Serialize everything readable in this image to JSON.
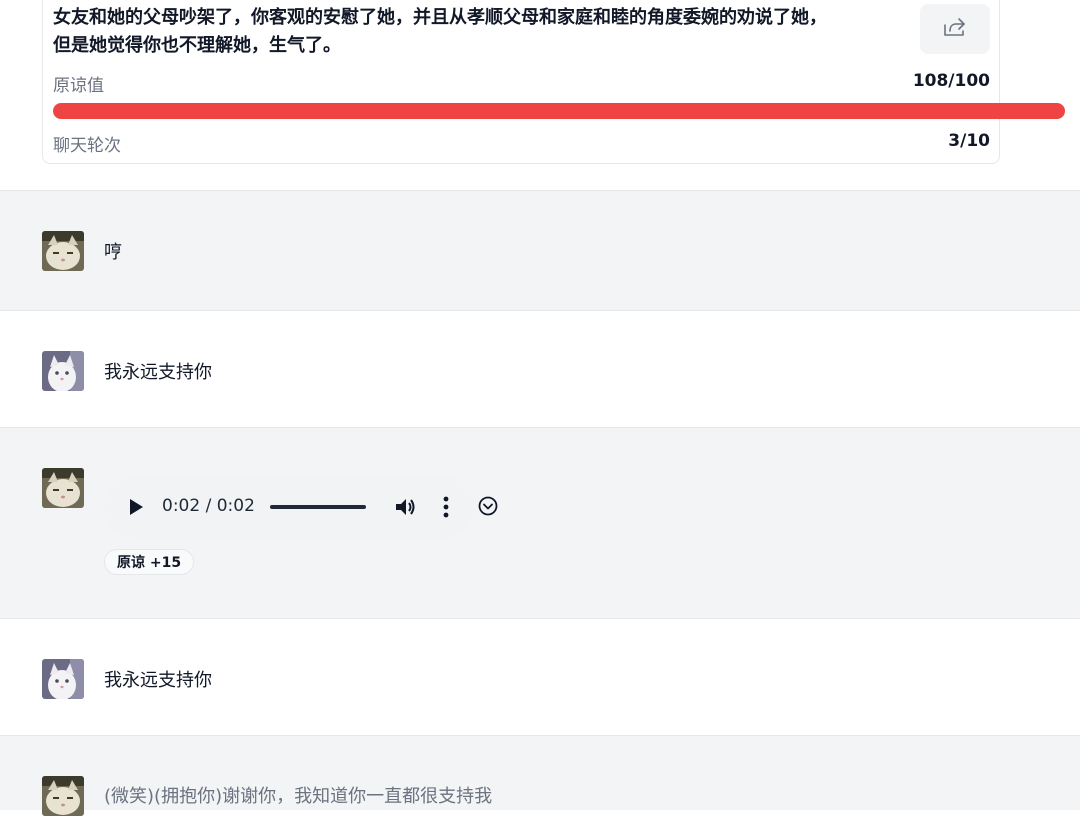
{
  "header": {
    "scenario": "女友和她的父母吵架了，你客观的安慰了她，并且从孝顺父母和家庭和睦的角度委婉的劝说了她，\n但是她觉得你也不理解她，生气了。",
    "forgiveness_label": "原谅值",
    "forgiveness_value": "108/100",
    "forgiveness_progress": 1.0,
    "rounds_label": "聊天轮次",
    "rounds_value": "3/10",
    "share_icon": "share-icon"
  },
  "messages": [
    {
      "role": "bot",
      "text": "哼"
    },
    {
      "role": "user",
      "text": "我永远支持你"
    },
    {
      "role": "bot",
      "audio_time": "0:02 / 0:02",
      "badge": "原谅 +15"
    },
    {
      "role": "user",
      "text": "我永远支持你"
    },
    {
      "role": "bot",
      "text": "(微笑)(拥抱你)谢谢你，我知道你一直都很支持我"
    }
  ],
  "colors": {
    "accent_red": "#ef4444",
    "bot_bg": "#f3f4f6",
    "user_bg": "#ffffff"
  }
}
